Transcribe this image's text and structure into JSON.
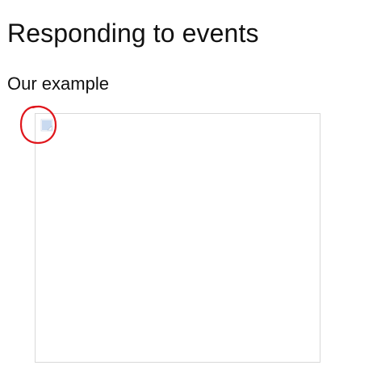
{
  "page": {
    "title": "Responding to events",
    "section_title": "Our example"
  },
  "example": {
    "icon": "broken-image-icon",
    "annotation_color": "#e0161c",
    "icon_color": "#c9daf0"
  }
}
